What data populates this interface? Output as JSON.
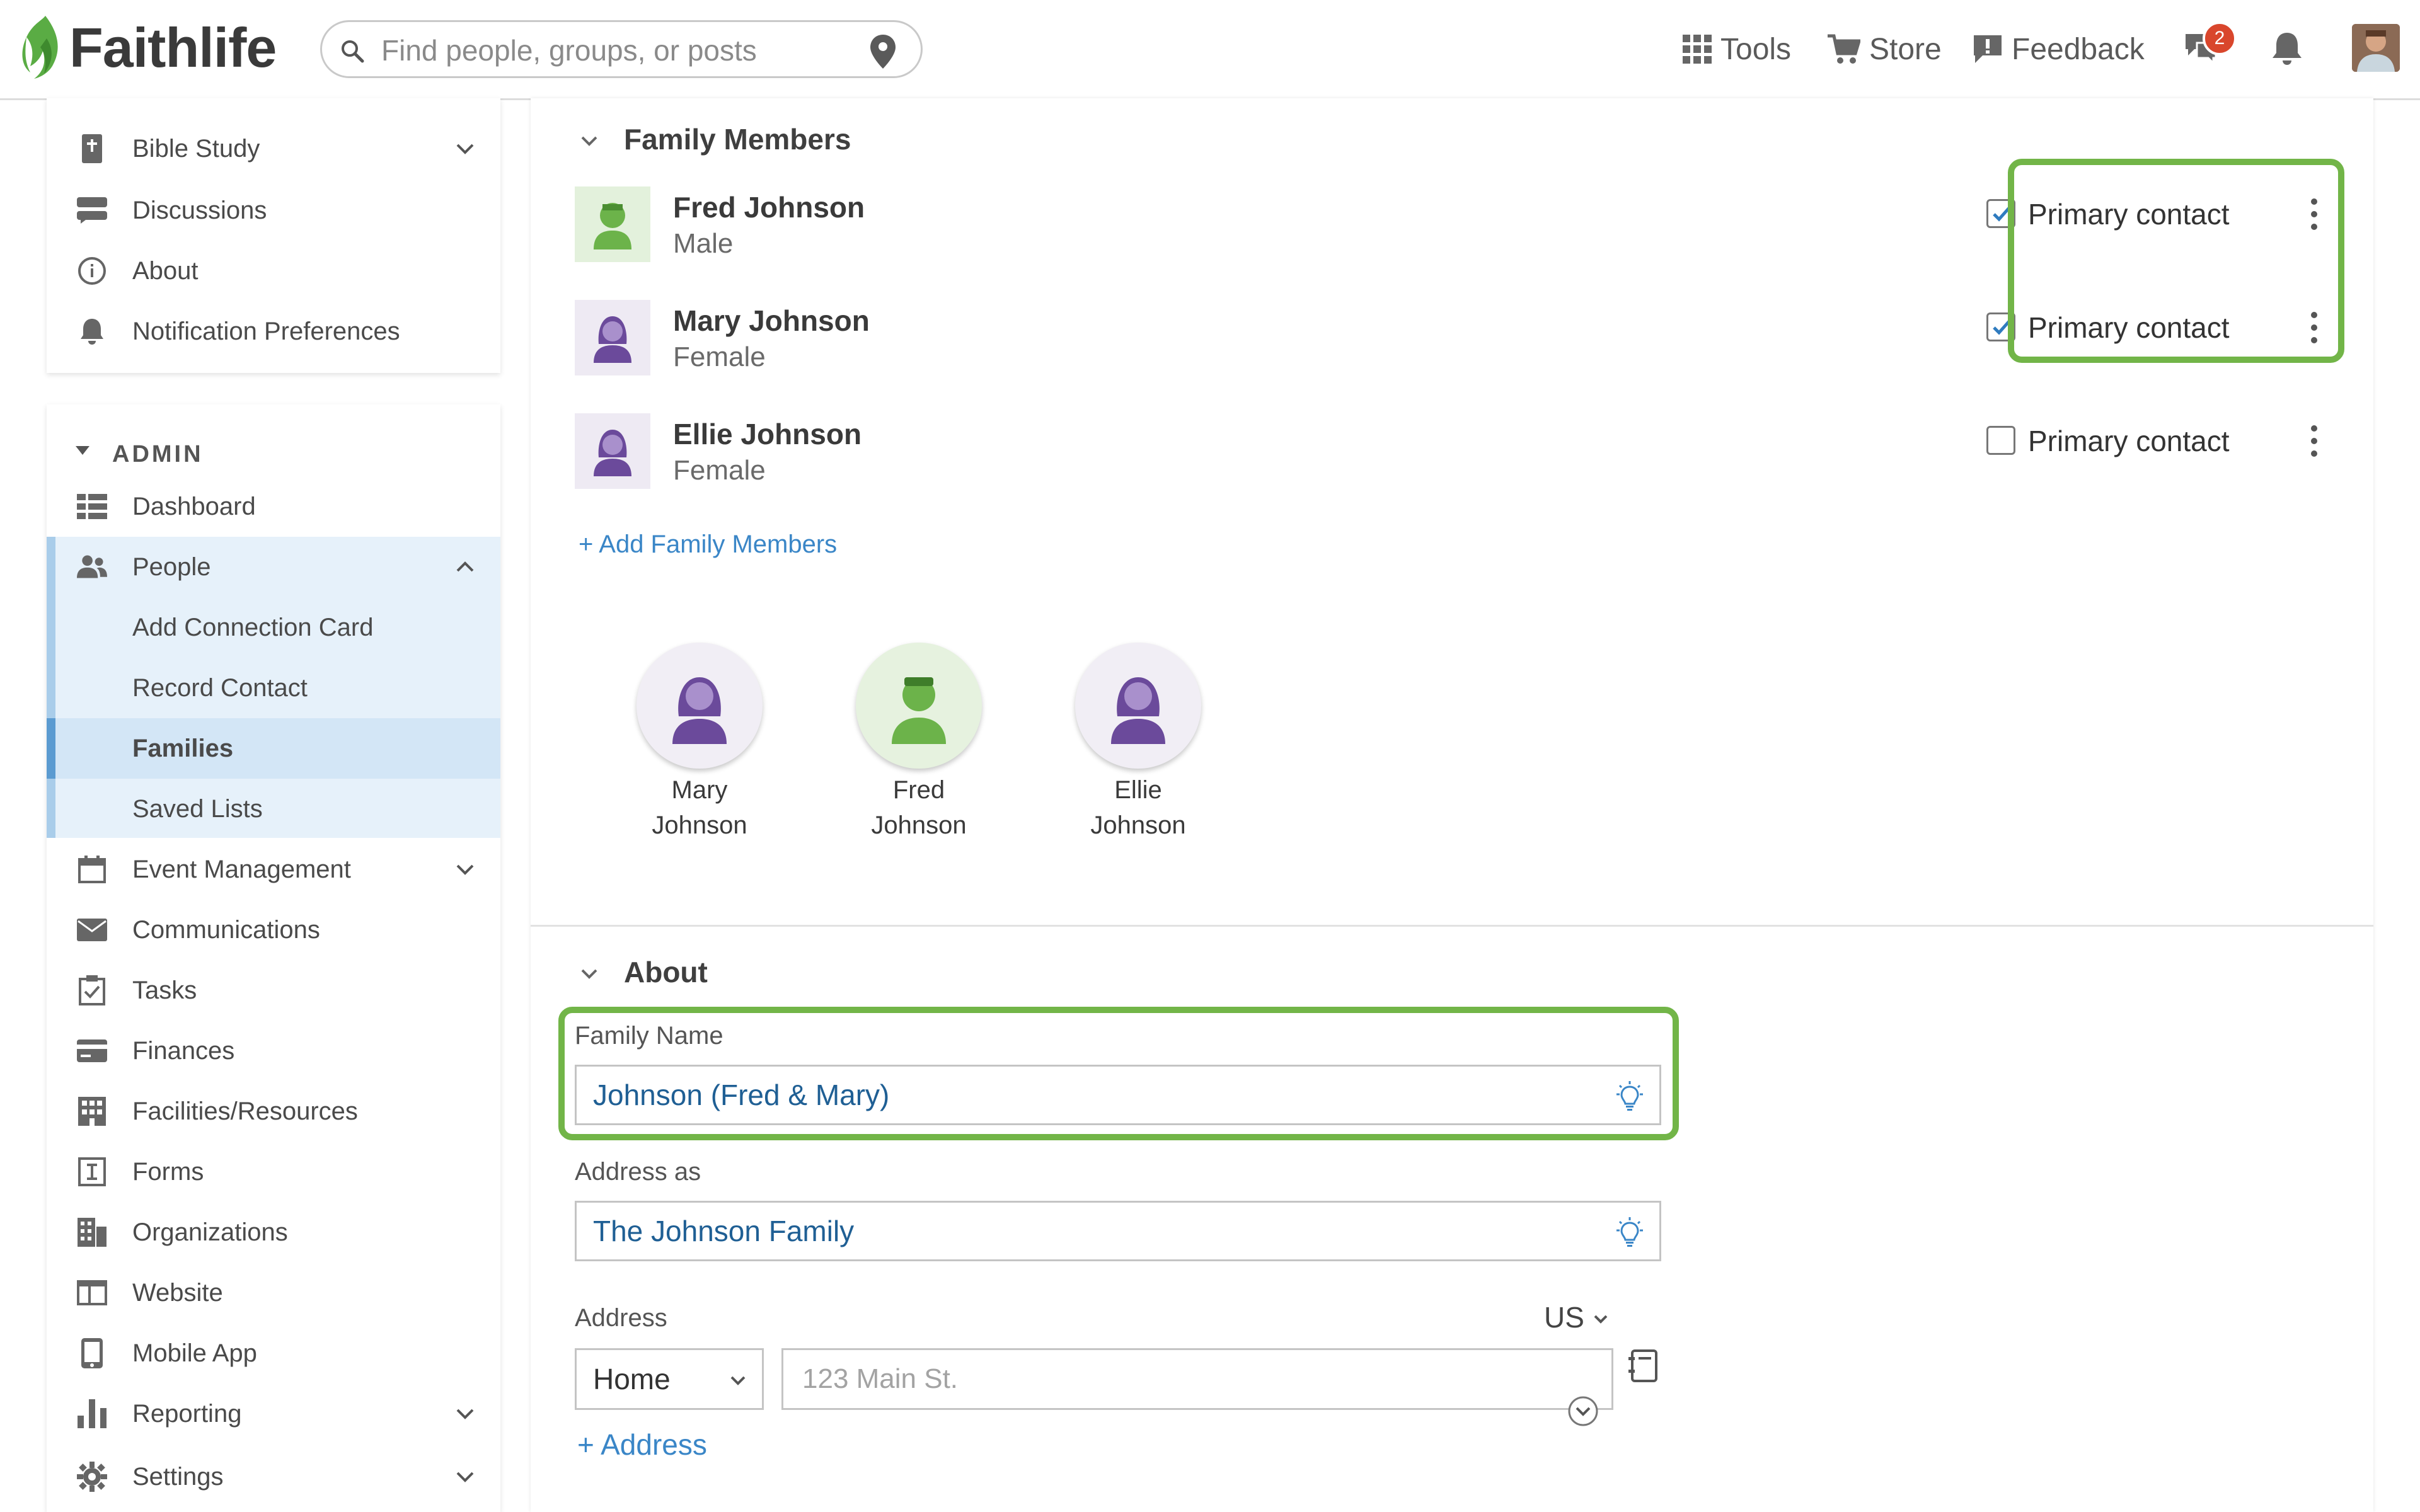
{
  "brand": {
    "name": "Faithlife",
    "color": "#5aac44"
  },
  "search": {
    "placeholder": "Find people, groups, or posts"
  },
  "nav": {
    "tools": "Tools",
    "store": "Store",
    "feedback": "Feedback",
    "messages_badge": "2"
  },
  "sidebar": {
    "top_items": [
      "Bible Study",
      "Discussions",
      "About",
      "Notification Preferences"
    ],
    "admin_header": "ADMIN",
    "admin_items": [
      "Dashboard",
      "People",
      "Event Management",
      "Communications",
      "Tasks",
      "Finances",
      "Facilities/Resources",
      "Forms",
      "Organizations",
      "Website",
      "Mobile App",
      "Reporting",
      "Settings"
    ],
    "people_sub": [
      "Add Connection Card",
      "Record Contact",
      "Families",
      "Saved Lists"
    ],
    "active": "Families"
  },
  "family_members": {
    "title": "Family Members",
    "primary_label": "Primary contact",
    "members": [
      {
        "name": "Fred Johnson",
        "gender": "Male",
        "primary": true
      },
      {
        "name": "Mary Johnson",
        "gender": "Female",
        "primary": true
      },
      {
        "name": "Ellie Johnson",
        "gender": "Female",
        "primary": false
      }
    ],
    "add_link": "+ Add Family Members",
    "tree": [
      {
        "first": "Mary",
        "last": "Johnson"
      },
      {
        "first": "Fred",
        "last": "Johnson"
      },
      {
        "first": "Ellie",
        "last": "Johnson"
      }
    ]
  },
  "about": {
    "title": "About",
    "family_name_label": "Family Name",
    "family_name_value": "Johnson (Fred & Mary)",
    "address_as_label": "Address as",
    "address_as_value": "The Johnson Family",
    "address_label": "Address",
    "country": "US",
    "address_type": "Home",
    "address_placeholder": "123 Main St.",
    "add_address": "+ Address"
  },
  "colors": {
    "male_avatar": "#6cb34a",
    "female_avatar": "#6b4a9b",
    "highlight_border": "#72b548",
    "link": "#3a86c7"
  }
}
